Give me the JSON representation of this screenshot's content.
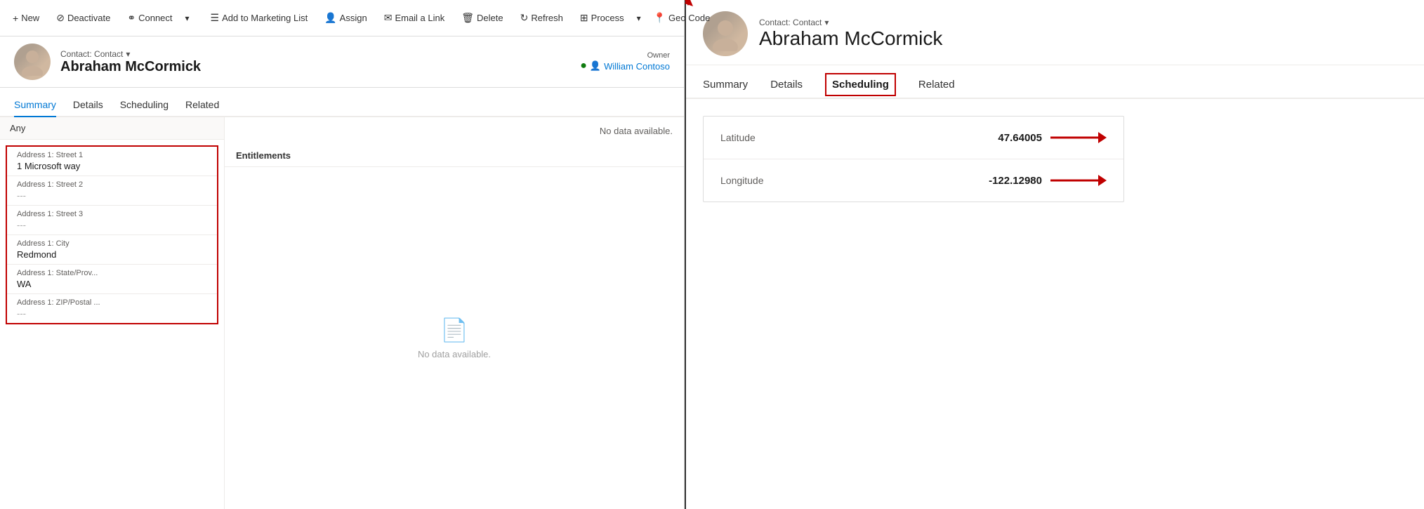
{
  "toolbar": {
    "buttons": [
      {
        "id": "new",
        "icon": "+",
        "label": "New"
      },
      {
        "id": "deactivate",
        "icon": "⊘",
        "label": "Deactivate"
      },
      {
        "id": "connect",
        "icon": "⚭",
        "label": "Connect"
      },
      {
        "id": "add-to-marketing",
        "icon": "☰",
        "label": "Add to Marketing List"
      },
      {
        "id": "assign",
        "icon": "👤",
        "label": "Assign"
      },
      {
        "id": "email-link",
        "icon": "✉",
        "label": "Email a Link"
      },
      {
        "id": "delete",
        "icon": "🗑",
        "label": "Delete"
      },
      {
        "id": "refresh",
        "icon": "↻",
        "label": "Refresh"
      },
      {
        "id": "process",
        "icon": "⊞",
        "label": "Process"
      },
      {
        "id": "geocode",
        "icon": "📍",
        "label": "Geo Code"
      }
    ],
    "chevron_label": "▾"
  },
  "record": {
    "entity": "Contact: Contact",
    "name": "Abraham McCormick",
    "owner_label": "Owner",
    "owner_name": "William Contoso"
  },
  "tabs": [
    {
      "id": "summary",
      "label": "Summary",
      "active": true
    },
    {
      "id": "details",
      "label": "Details",
      "active": false
    },
    {
      "id": "scheduling",
      "label": "Scheduling",
      "active": false
    },
    {
      "id": "related",
      "label": "Related",
      "active": false
    }
  ],
  "address_section": {
    "header": "Any",
    "fields": [
      {
        "label": "Address 1: Street 1",
        "value": "1 Microsoft way",
        "empty": false
      },
      {
        "label": "Address 1: Street 2",
        "value": "---",
        "empty": true
      },
      {
        "label": "Address 1: Street 3",
        "value": "---",
        "empty": true
      },
      {
        "label": "Address 1: City",
        "value": "Redmond",
        "empty": false
      },
      {
        "label": "Address 1: State/Prov...",
        "value": "WA",
        "empty": false
      },
      {
        "label": "Address 1: ZIP/Postal ...",
        "value": "---",
        "empty": true
      }
    ]
  },
  "no_data_label": "No data available.",
  "entitlements": {
    "header": "Entitlements",
    "no_data_label": "No data available."
  },
  "right_panel": {
    "entity": "Contact: Contact",
    "name": "Abraham McCormick",
    "tabs": [
      {
        "id": "summary",
        "label": "Summary",
        "active": false
      },
      {
        "id": "details",
        "label": "Details",
        "active": false
      },
      {
        "id": "scheduling",
        "label": "Scheduling",
        "active": true
      },
      {
        "id": "related",
        "label": "Related",
        "active": false
      }
    ],
    "geo": {
      "latitude_label": "Latitude",
      "latitude_value": "47.64005",
      "longitude_label": "Longitude",
      "longitude_value": "-122.12980"
    }
  }
}
